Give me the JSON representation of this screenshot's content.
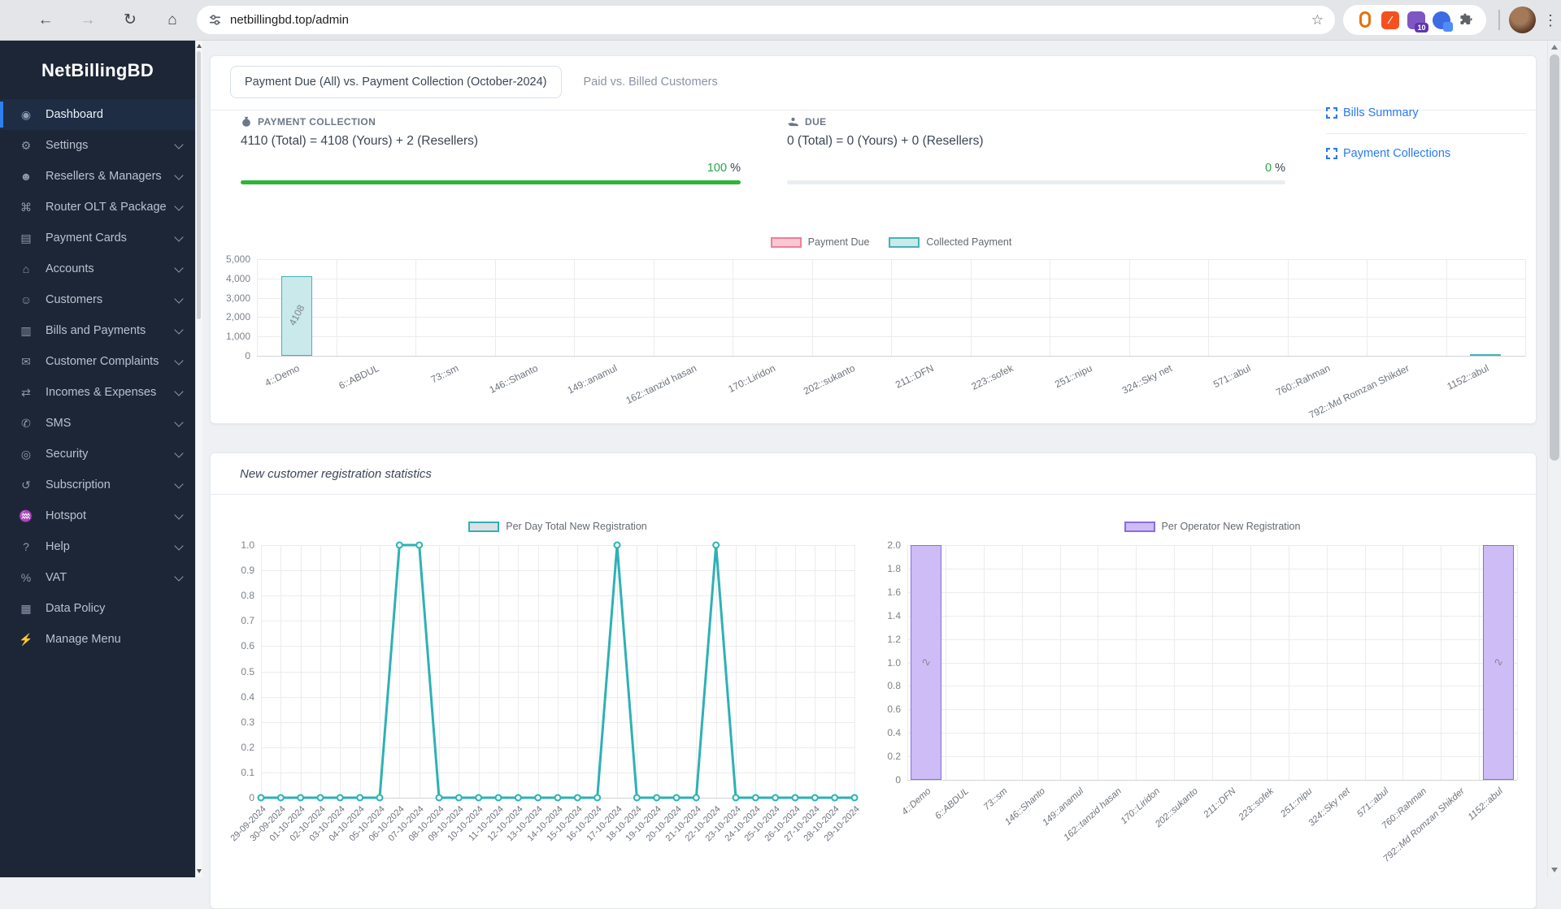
{
  "browser": {
    "url": "netbillingbd.top/admin",
    "extension_badge": "10"
  },
  "sidebar": {
    "brand": "NetBillingBD",
    "items": [
      {
        "label": "Dashboard",
        "icon": "palette-icon",
        "glyph": "◉",
        "chevron": false,
        "active": true
      },
      {
        "label": "Settings",
        "icon": "gear-icon",
        "glyph": "⚙",
        "chevron": true
      },
      {
        "label": "Resellers & Managers",
        "icon": "user-gear-icon",
        "glyph": "☻",
        "chevron": true
      },
      {
        "label": "Router OLT & Package",
        "icon": "sitemap-icon",
        "glyph": "⌘",
        "chevron": true
      },
      {
        "label": "Payment Cards",
        "icon": "credit-card-icon",
        "glyph": "▤",
        "chevron": true
      },
      {
        "label": "Accounts",
        "icon": "bank-icon",
        "glyph": "⌂",
        "chevron": true
      },
      {
        "label": "Customers",
        "icon": "users-icon",
        "glyph": "☺",
        "chevron": true
      },
      {
        "label": "Bills and Payments",
        "icon": "invoice-icon",
        "glyph": "▥",
        "chevron": true
      },
      {
        "label": "Customer Complaints",
        "icon": "complaint-icon",
        "glyph": "✉",
        "chevron": true
      },
      {
        "label": "Incomes & Expenses",
        "icon": "money-exchange-icon",
        "glyph": "⇄",
        "chevron": true
      },
      {
        "label": "SMS",
        "icon": "sms-icon",
        "glyph": "✆",
        "chevron": true
      },
      {
        "label": "Security",
        "icon": "fingerprint-icon",
        "glyph": "◎",
        "chevron": true
      },
      {
        "label": "Subscription",
        "icon": "history-icon",
        "glyph": "↺",
        "chevron": true
      },
      {
        "label": "Hotspot",
        "icon": "wifi-icon",
        "glyph": "♒",
        "chevron": true
      },
      {
        "label": "Help",
        "icon": "help-icon",
        "glyph": "?",
        "chevron": true
      },
      {
        "label": "VAT",
        "icon": "percent-icon",
        "glyph": "%",
        "chevron": true
      },
      {
        "label": "Data Policy",
        "icon": "file-icon",
        "glyph": "▦",
        "chevron": false
      },
      {
        "label": "Manage Menu",
        "icon": "plug-icon",
        "glyph": "⚡",
        "chevron": false
      }
    ]
  },
  "page": {
    "tabs": [
      {
        "label": "Payment Due (All) vs. Payment Collection (October-2024)",
        "active": true
      },
      {
        "label": "Paid vs. Billed Customers",
        "active": false
      }
    ],
    "collection": {
      "heading": "PAYMENT COLLECTION",
      "value": "4110 (Total) = 4108 (Yours) + 2 (Resellers)",
      "percent": "100",
      "unit": "%"
    },
    "due": {
      "heading": "DUE",
      "value": "0 (Total) = 0 (Yours) + 0 (Resellers)",
      "percent": "0",
      "unit": "%"
    },
    "links": {
      "bills": "Bills Summary",
      "payments": "Payment Collections"
    },
    "registration_title": "New customer registration statistics"
  },
  "colors": {
    "accent_blue": "#2a7af2",
    "success_green": "#28a745",
    "sidebar_bg": "#1d2636",
    "teal": "#45b3b6",
    "pink": "#f37c9b",
    "purple": "#8b6ce3"
  },
  "chart_data": [
    {
      "id": "payment-due-vs-collection",
      "type": "bar",
      "categories": [
        "4::Demo",
        "6::ABDUL",
        "73::sm",
        "146::Shanto",
        "149::anamul",
        "162::tanzid hasan",
        "170::Liridon",
        "202::sukanto",
        "211::DFN",
        "223::sofek",
        "251::nipu",
        "324::Sky net",
        "571::abul",
        "760::Rahman",
        "792::Md Romzan Shikder",
        "1152::abul"
      ],
      "series": [
        {
          "name": "Payment Due",
          "fill": "#f9c9d3",
          "border": "#f37c9b",
          "values": [
            0,
            0,
            0,
            0,
            0,
            0,
            0,
            0,
            0,
            0,
            0,
            0,
            0,
            0,
            0,
            0
          ]
        },
        {
          "name": "Collected Payment",
          "fill": "#c9e9ea",
          "border": "#45b3b6",
          "values": [
            4108,
            0,
            0,
            0,
            0,
            0,
            0,
            0,
            0,
            0,
            0,
            0,
            0,
            0,
            0,
            2
          ]
        }
      ],
      "ymax": 5000,
      "yticks": [
        "5,000",
        "4,000",
        "3,000",
        "2,000",
        "1,000",
        "0"
      ],
      "legend_position": "top",
      "grid": true
    },
    {
      "id": "per-day-new-registration",
      "type": "line",
      "categories": [
        "29-09-2024",
        "30-09-2024",
        "01-10-2024",
        "02-10-2024",
        "03-10-2024",
        "04-10-2024",
        "05-10-2024",
        "06-10-2024",
        "07-10-2024",
        "08-10-2024",
        "09-10-2024",
        "10-10-2024",
        "11-10-2024",
        "12-10-2024",
        "13-10-2024",
        "14-10-2024",
        "15-10-2024",
        "16-10-2024",
        "17-10-2024",
        "18-10-2024",
        "19-10-2024",
        "20-10-2024",
        "21-10-2024",
        "22-10-2024",
        "23-10-2024",
        "24-10-2024",
        "25-10-2024",
        "26-10-2024",
        "27-10-2024",
        "28-10-2024",
        "29-10-2024"
      ],
      "series": [
        {
          "name": "Per Day Total New Registration",
          "fill": "#2eb1b4",
          "border": "#2eb1b4",
          "legend_fill": "#dcdfe3",
          "values": [
            0,
            0,
            0,
            0,
            0,
            0,
            0,
            1,
            1,
            0,
            0,
            0,
            0,
            0,
            0,
            0,
            0,
            0,
            1,
            0,
            0,
            0,
            0,
            1,
            0,
            0,
            0,
            0,
            0,
            0,
            0
          ]
        }
      ],
      "ymax": 1.0,
      "yticks": [
        "1.0",
        "0.9",
        "0.8",
        "0.7",
        "0.6",
        "0.5",
        "0.4",
        "0.3",
        "0.2",
        "0.1",
        "0"
      ],
      "legend_position": "top",
      "grid": true
    },
    {
      "id": "per-operator-new-registration",
      "type": "bar",
      "categories": [
        "4::Demo",
        "6::ABDUL",
        "73::sm",
        "146::Shanto",
        "149::anamul",
        "162::tanzid hasan",
        "170::Liridon",
        "202::sukanto",
        "211::DFN",
        "223::sofek",
        "251::nipu",
        "324::Sky net",
        "571::abul",
        "760::Rahman",
        "792::Md Romzan Shikder",
        "1152::abul"
      ],
      "series": [
        {
          "name": "Per Operator New Registration",
          "fill": "#cdbcf6",
          "border": "#8b6ce3",
          "values": [
            2,
            0,
            0,
            0,
            0,
            0,
            0,
            0,
            0,
            0,
            0,
            0,
            0,
            0,
            0,
            2
          ]
        }
      ],
      "ymax": 2.0,
      "yticks": [
        "2.0",
        "1.8",
        "1.6",
        "1.4",
        "1.2",
        "1.0",
        "0.8",
        "0.6",
        "0.4",
        "0.2",
        "0"
      ],
      "legend_position": "top",
      "grid": true
    }
  ]
}
